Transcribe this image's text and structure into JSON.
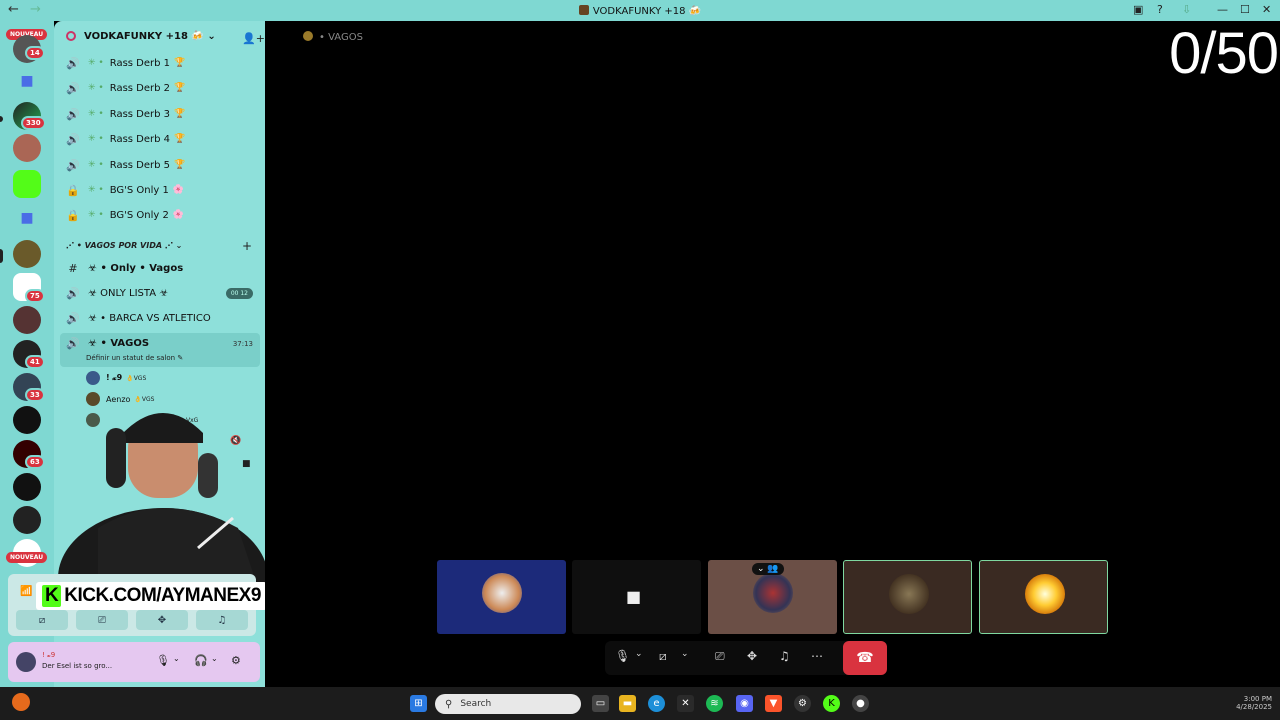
{
  "window": {
    "title": "VODKAFUNKY +18 🍻"
  },
  "counter": "0/50",
  "rail": {
    "nouveau_top": "NOUVEAU",
    "nouveau_bottom": "NOUVEAU",
    "badges": [
      "14",
      "330",
      "75",
      "41",
      "33",
      "63"
    ]
  },
  "guild": {
    "name": "VODKAFUNKY +18 🍻"
  },
  "channels": [
    {
      "name": "Rass Derb 1",
      "emoji": "🏆",
      "icon": "speaker-icon"
    },
    {
      "name": "Rass Derb 2",
      "emoji": "🏆",
      "icon": "speaker-icon"
    },
    {
      "name": "Rass Derb 3",
      "emoji": "🏆",
      "icon": "speaker-icon"
    },
    {
      "name": "Rass Derb 4",
      "emoji": "🏆",
      "icon": "speaker-icon"
    },
    {
      "name": "Rass Derb 5",
      "emoji": "🏆",
      "icon": "speaker-icon"
    },
    {
      "name": "BG'S Only 1",
      "emoji": "🌸",
      "icon": "lock-icon"
    },
    {
      "name": "BG'S Only 2",
      "emoji": "🌸",
      "icon": "lock-icon"
    }
  ],
  "category": {
    "name": "⋰ • VAGOS POR VIDA ⋰ ⌄"
  },
  "vagos_channels": [
    {
      "name": "☣ • Only • Vagos",
      "icon": "hash-icon"
    },
    {
      "name": "☣ ONLY LISTA ☣",
      "icon": "speaker-icon",
      "pill": "00 12"
    },
    {
      "name": "☣ • BARCA VS ATLETICO",
      "icon": "speaker-icon"
    },
    {
      "name": "☣ • VAGOS",
      "icon": "speaker-icon",
      "timer": "37:13"
    }
  ],
  "active_channel": {
    "status": "Définir un statut de salon ✎"
  },
  "members": [
    {
      "name": "! 𝔁9",
      "tag": "👌VGS"
    },
    {
      "name": "Aenzo",
      "tag": "👌VGS"
    },
    {
      "name": "",
      "tag": "VxG"
    }
  ],
  "voice_panel": {
    "buttons": [
      "camera-off",
      "screen-share",
      "activities",
      "soundboard"
    ]
  },
  "user": {
    "name": "! 𝔁9",
    "status": "Der Esel ist so gro..."
  },
  "main": {
    "channel_title": "• VAGOS"
  },
  "kick": {
    "brand": "K",
    "text": "KICK.COM/AYMANEX9"
  },
  "taskbar": {
    "search_placeholder": "Search",
    "time": "3:00 PM",
    "date": "4/28/2025"
  },
  "colors": {
    "accent": "#7fd8d2",
    "danger": "#d9333f",
    "kick_green": "#53fc18"
  }
}
